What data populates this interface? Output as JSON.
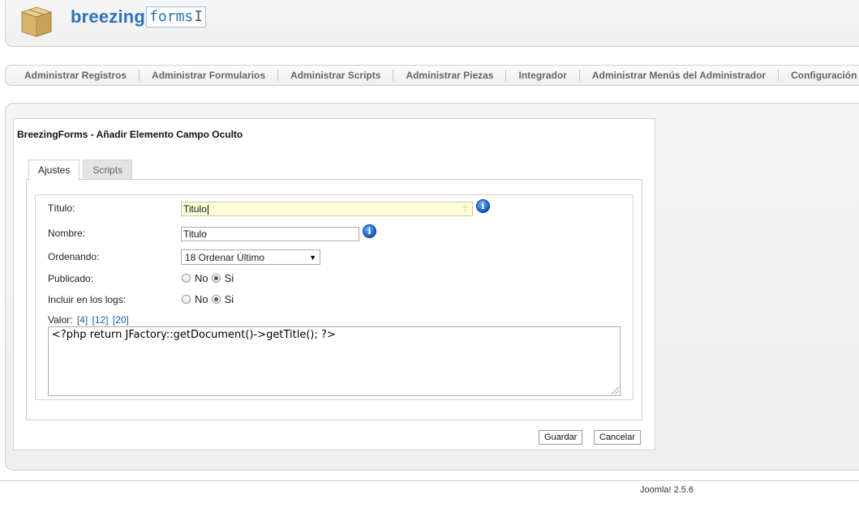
{
  "header": {
    "logo_icon": "package-box-icon",
    "logo_part1": "breezing",
    "logo_part2": "forms",
    "logo_cursor": "I"
  },
  "nav": {
    "items": [
      "Administrar Registros",
      "Administrar Formularios",
      "Administrar Scripts",
      "Administrar Piezas",
      "Integrador",
      "Administrar Menús del Administrador",
      "Configuración"
    ]
  },
  "panel": {
    "title": "BreezingForms - Añadir Elemento Campo Oculto",
    "tabs": [
      "Ajustes",
      "Scripts"
    ],
    "active_tab": "Ajustes"
  },
  "form": {
    "titulo_label": "Título:",
    "titulo_value": "Titulo",
    "nombre_label": "Nombre:",
    "nombre_value": "Titulo",
    "ordenando_label": "Ordenando:",
    "ordenando_value": "18 Ordenar Último",
    "publicado_label": "Publicado:",
    "publicado_options": [
      "No",
      "Si"
    ],
    "publicado_selected": "Si",
    "logs_label": "Incluir en los logs:",
    "logs_options": [
      "No",
      "Si"
    ],
    "logs_selected": "Si",
    "valor_label": "Valor:",
    "valor_links": [
      "[4]",
      "[12]",
      "[20]"
    ],
    "valor_code": "<?php return JFactory::getDocument()->getTitle(); ?>"
  },
  "buttons": {
    "save": "Guardar",
    "cancel": "Cancelar"
  },
  "footer": {
    "version": "Joomla! 2.5.6"
  },
  "colors": {
    "accent": "#2a73b8",
    "link": "#1a5fb4",
    "focused_input": "#ffffd8"
  }
}
